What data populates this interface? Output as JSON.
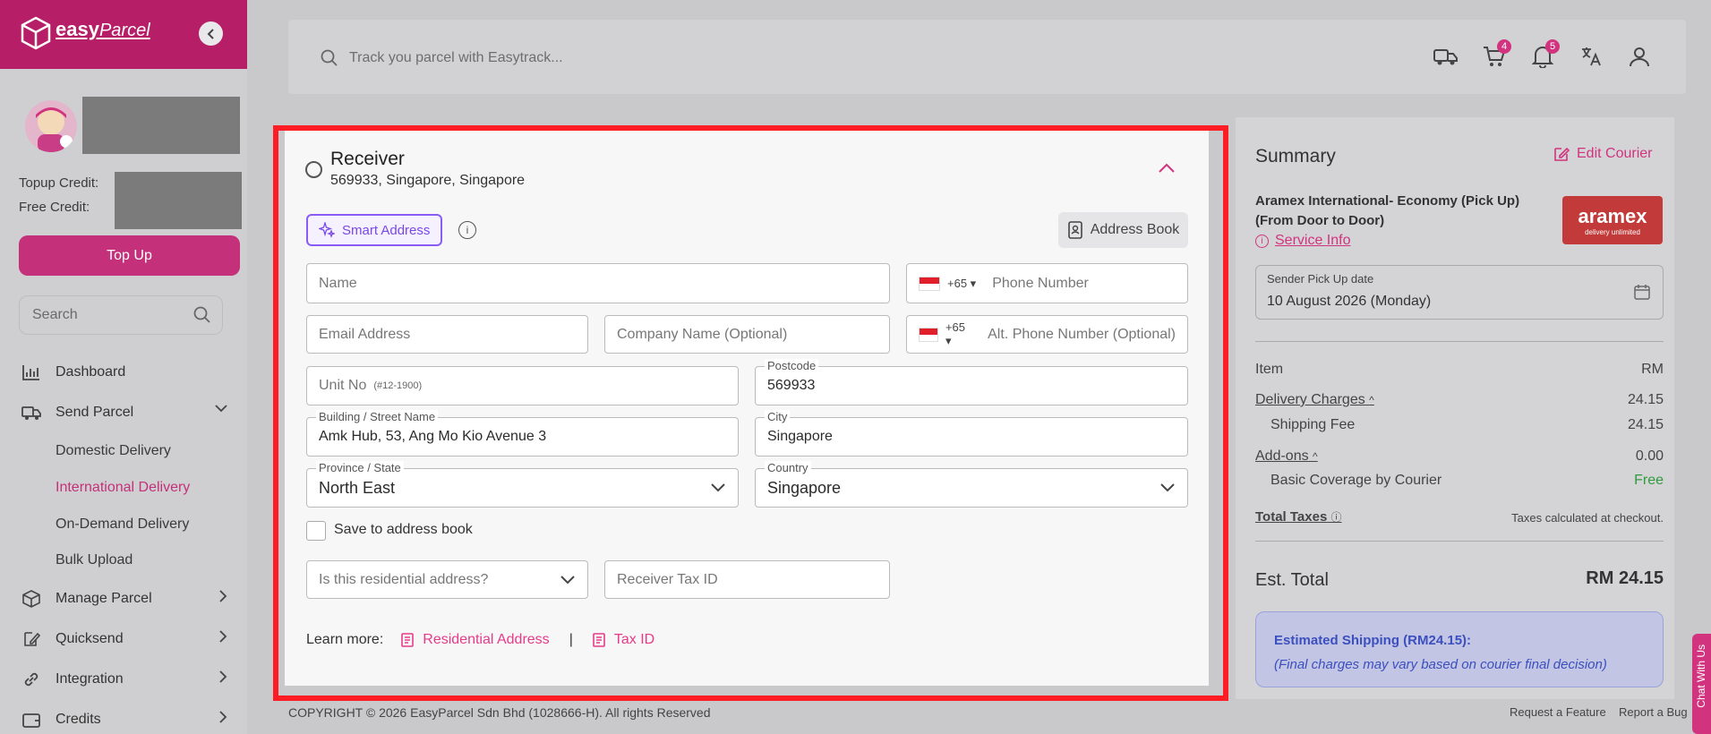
{
  "brand": {
    "name": "easy",
    "name2": "Parcel"
  },
  "sidebar": {
    "topup_credit_label": "Topup Credit:",
    "free_credit_label": "Free Credit:",
    "topup_button": "Top Up",
    "search_placeholder": "Search",
    "nav": [
      {
        "label": "Dashboard",
        "icon": "bar-chart-icon"
      },
      {
        "label": "Send Parcel",
        "icon": "truck-icon"
      },
      {
        "label": "Manage Parcel",
        "icon": "box-icon"
      },
      {
        "label": "Quicksend",
        "icon": "edit-icon"
      },
      {
        "label": "Integration",
        "icon": "link-icon"
      },
      {
        "label": "Credits",
        "icon": "wallet-icon"
      }
    ],
    "subnav": [
      {
        "label": "Domestic Delivery"
      },
      {
        "label": "International Delivery"
      },
      {
        "label": "On-Demand Delivery"
      },
      {
        "label": "Bulk Upload"
      }
    ]
  },
  "topbar": {
    "search_placeholder": "Track you parcel with Easytrack...",
    "cart_count": "4",
    "notif_count": "5"
  },
  "receiver": {
    "title": "Receiver",
    "subtitle": "569933, Singapore, Singapore",
    "smart_address": "Smart Address",
    "address_book": "Address Book",
    "name_placeholder": "Name",
    "country_code": "+65",
    "phone_placeholder": "Phone Number",
    "email_placeholder": "Email Address",
    "company_placeholder": "Company Name (Optional)",
    "alt_phone_placeholder": "Alt. Phone Number (Optional)",
    "unit_placeholder": "Unit No",
    "unit_hint": "(#12-1900)",
    "postcode_label": "Postcode",
    "postcode": "569933",
    "street_label": "Building / Street Name",
    "street": "Amk Hub, 53, Ang Mo Kio Avenue 3",
    "city_label": "City",
    "city": "Singapore",
    "province_label": "Province / State",
    "province": "North East",
    "country_label": "Country",
    "country": "Singapore",
    "save_label": "Save to address book",
    "residential_placeholder": "Is this residential address?",
    "tax_placeholder": "Receiver Tax ID",
    "learn_more": "Learn more:",
    "link_residential": "Residential Address",
    "separator": "|",
    "link_tax": "Tax ID"
  },
  "summary": {
    "title": "Summary",
    "edit_courier": "Edit Courier",
    "courier_line1": "Aramex International- Economy (Pick Up)",
    "courier_line2": "(From Door to Door)",
    "service_info": "Service Info",
    "courier_logo": "aramex",
    "courier_tagline": "delivery unlimited",
    "pickup_label": "Sender Pick Up date",
    "pickup_date": "10 August 2026 (Monday)",
    "item_label": "Item",
    "currency": "RM",
    "delivery_charges": "Delivery Charges",
    "delivery_value": "24.15",
    "shipping_fee": "Shipping Fee",
    "shipping_value": "24.15",
    "addons": "Add-ons",
    "addons_value": "0.00",
    "basic_coverage": "Basic Coverage by Courier",
    "basic_value": "Free",
    "total_taxes": "Total Taxes",
    "taxes_note": "Taxes calculated at checkout.",
    "est_total": "Est. Total",
    "est_total_value": "RM 24.15",
    "est_shipping": "Estimated Shipping (RM24.15):",
    "est_note": "(Final charges may vary based on courier final decision)"
  },
  "footer": {
    "copyright": "COPYRIGHT © 2026 EasyParcel Sdn Bhd (1028666-H). All rights Reserved",
    "request_feature": "Request a Feature",
    "report_bug": "Report a Bug"
  },
  "chat": {
    "label": "Chat With Us"
  },
  "colors": {
    "brand": "#b61f68",
    "accent": "#d2337f",
    "highlight": "#ff1d25"
  }
}
